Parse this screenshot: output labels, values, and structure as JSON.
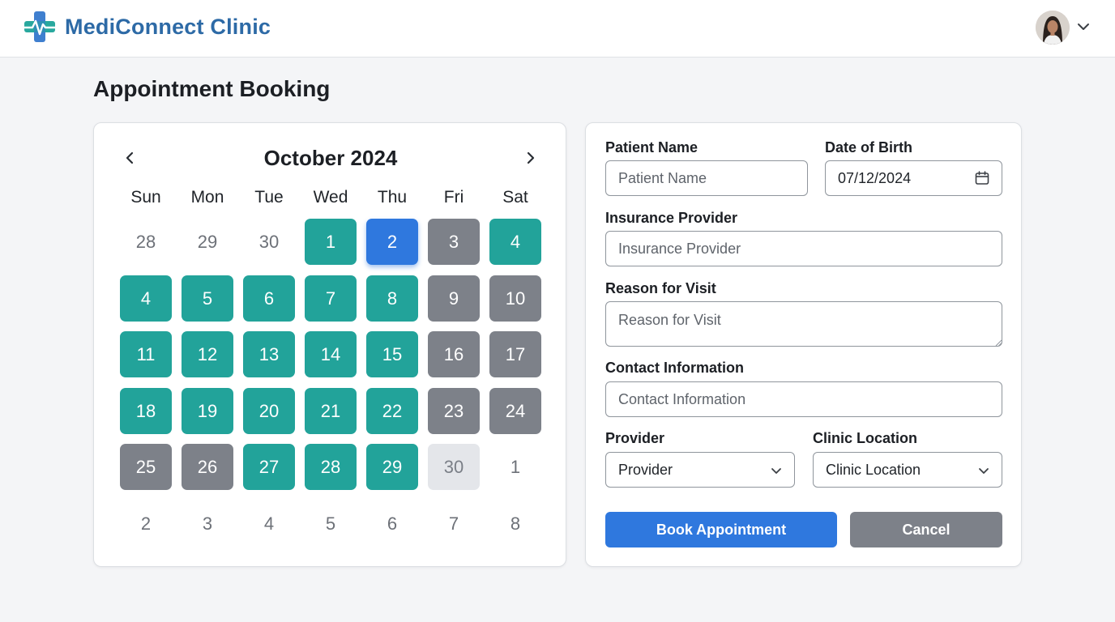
{
  "app": {
    "name": "MediConnect Clinic"
  },
  "page": {
    "title": "Appointment Booking"
  },
  "calendar": {
    "month_label": "October 2024",
    "weekdays": [
      "Sun",
      "Mon",
      "Tue",
      "Wed",
      "Thu",
      "Fri",
      "Sat"
    ],
    "weeks": [
      [
        {
          "day": "28",
          "state": "outside"
        },
        {
          "day": "29",
          "state": "outside"
        },
        {
          "day": "30",
          "state": "outside"
        },
        {
          "day": "1",
          "state": "available"
        },
        {
          "day": "2",
          "state": "selected"
        },
        {
          "day": "3",
          "state": "booked"
        },
        {
          "day": "4",
          "state": "available"
        }
      ],
      [
        {
          "day": "4",
          "state": "available"
        },
        {
          "day": "5",
          "state": "available"
        },
        {
          "day": "6",
          "state": "available"
        },
        {
          "day": "7",
          "state": "available"
        },
        {
          "day": "8",
          "state": "available"
        },
        {
          "day": "9",
          "state": "booked"
        },
        {
          "day": "10",
          "state": "booked"
        }
      ],
      [
        {
          "day": "11",
          "state": "available"
        },
        {
          "day": "12",
          "state": "available"
        },
        {
          "day": "13",
          "state": "available"
        },
        {
          "day": "14",
          "state": "available"
        },
        {
          "day": "15",
          "state": "available"
        },
        {
          "day": "16",
          "state": "booked"
        },
        {
          "day": "17",
          "state": "booked"
        }
      ],
      [
        {
          "day": "18",
          "state": "available"
        },
        {
          "day": "19",
          "state": "available"
        },
        {
          "day": "20",
          "state": "available"
        },
        {
          "day": "21",
          "state": "available"
        },
        {
          "day": "22",
          "state": "available"
        },
        {
          "day": "23",
          "state": "booked"
        },
        {
          "day": "24",
          "state": "booked"
        }
      ],
      [
        {
          "day": "25",
          "state": "booked"
        },
        {
          "day": "26",
          "state": "booked"
        },
        {
          "day": "27",
          "state": "available"
        },
        {
          "day": "28",
          "state": "available"
        },
        {
          "day": "29",
          "state": "available"
        },
        {
          "day": "30",
          "state": "disabled"
        },
        {
          "day": "1",
          "state": "outside"
        }
      ],
      [
        {
          "day": "2",
          "state": "outside"
        },
        {
          "day": "3",
          "state": "outside"
        },
        {
          "day": "4",
          "state": "outside"
        },
        {
          "day": "5",
          "state": "outside"
        },
        {
          "day": "6",
          "state": "outside"
        },
        {
          "day": "7",
          "state": "outside"
        },
        {
          "day": "8",
          "state": "outside"
        }
      ]
    ]
  },
  "form": {
    "patient_name": {
      "label": "Patient Name",
      "placeholder": "Patient Name"
    },
    "dob": {
      "label": "Date of Birth",
      "value": "07/12/2024"
    },
    "insurance": {
      "label": "Insurance Provider",
      "placeholder": "Insurance Provider"
    },
    "reason": {
      "label": "Reason for Visit",
      "placeholder": "Reason for Visit"
    },
    "contact": {
      "label": "Contact Information",
      "placeholder": "Contact Information"
    },
    "provider": {
      "label": "Provider",
      "value": "Provider"
    },
    "location": {
      "label": "Clinic Location",
      "value": "Clinic Location"
    },
    "book_label": "Book Appointment",
    "cancel_label": "Cancel"
  },
  "colors": {
    "brand": "#2d6aa6",
    "available": "#22a39a",
    "booked": "#7d8189",
    "selected": "#2f78de",
    "disabled": "#e4e6ea",
    "primary_button": "#2f78de",
    "secondary_button": "#7d8189"
  },
  "icons": {
    "logo": "medical-cross-heartbeat-icon",
    "prev": "chevron-left-icon",
    "next": "chevron-right-icon",
    "account_menu": "chevron-down-icon",
    "date_picker": "calendar-icon",
    "select": "chevron-down-icon"
  }
}
